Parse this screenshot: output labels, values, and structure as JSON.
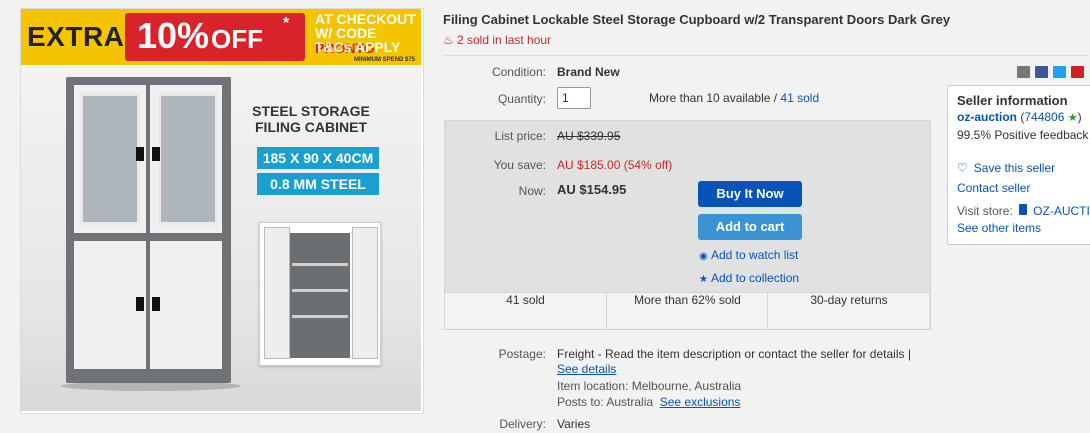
{
  "banner": {
    "extra": "EXTRA",
    "percent": "10%",
    "off": "OFF",
    "asterisk": "*",
    "line1": "AT CHECKOUT",
    "line2_prefix": "W/ CODE ",
    "code": "PRONTO",
    "line3": "T&Cs APPLY",
    "min_spend": "MINIMUM SPEND $75"
  },
  "image": {
    "sticker_title_1": "STEEL STORAGE",
    "sticker_title_2": "FILING CABINET",
    "spec_1": "185 X 90 X 40CM",
    "spec_2": "0.8 MM STEEL"
  },
  "product": {
    "title": "Filing Cabinet Lockable Steel Storage Cupboard w/2 Transparent Doors Dark Grey",
    "sold_hour": "2 sold in last hour"
  },
  "details": {
    "condition_label": "Condition:",
    "condition_value": "Brand New",
    "quantity_label": "Quantity:",
    "quantity_value": "1",
    "availability": "More than 10 available / ",
    "sold_link": "41 sold"
  },
  "price": {
    "list_label": "List price:",
    "list_value": "AU $339.95",
    "save_label": "You save:",
    "save_value": "AU $185.00 (54% off)",
    "now_label": "Now:",
    "now_value": "AU $154.95"
  },
  "actions": {
    "buy": "Buy It Now",
    "cart": "Add to cart",
    "watch": "Add to watch list",
    "collection": "Add to collection"
  },
  "stats": {
    "sold": "41 sold",
    "percent_sold": "More than 62% sold",
    "returns": "30-day returns"
  },
  "postage": {
    "label": "Postage:",
    "text": "Freight - Read the item description or contact the seller for details |",
    "details_link": "See details",
    "location": "Item location: Melbourne, Australia",
    "posts_to_prefix": "Posts to: Australia",
    "exclusions_link": "See exclusions"
  },
  "delivery": {
    "label": "Delivery:",
    "value": "Varies"
  },
  "seller": {
    "heading": "Seller information",
    "name": "oz-auction",
    "score_open": "(",
    "score": "744806",
    "score_close": ")",
    "feedback": "99.5% Positive feedback",
    "save": "Save this seller",
    "contact": "Contact seller",
    "visit_label": "Visit store:",
    "store_name": "OZ-AUCTION",
    "other_items": "See other items"
  },
  "colors": {
    "link": "#0654ba",
    "red": "#c7292b",
    "buy_button": "#0654ba",
    "cart_button": "#3a93d2",
    "banner_yellow": "#f5c400",
    "banner_red": "#d8232a",
    "spec_blue": "#1a9fd0"
  }
}
